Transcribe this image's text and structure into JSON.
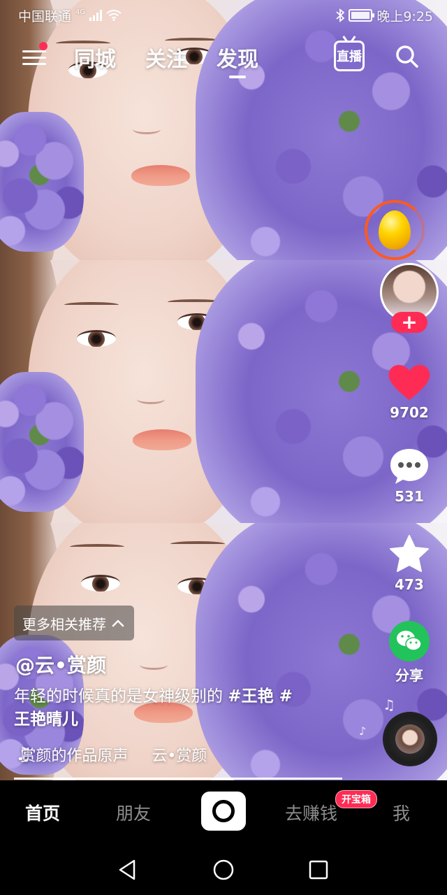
{
  "status_bar": {
    "carrier": "中国联通",
    "network": "4G",
    "time": "晚上9:25"
  },
  "top_nav": {
    "tabs": [
      {
        "label": "同城",
        "active": false
      },
      {
        "label": "关注",
        "active": false
      },
      {
        "label": "发现",
        "active": true
      }
    ],
    "live_label": "直播",
    "icons": [
      "menu-icon",
      "live-icon",
      "search-icon"
    ]
  },
  "right_rail": {
    "coin_timer_icon": "golden-egg-icon",
    "follow_label": "+",
    "likes": "9702",
    "comments": "531",
    "favorites": "473",
    "share_label": "分享",
    "icons": [
      "heart-icon",
      "comment-icon",
      "star-icon",
      "wechat-icon",
      "music-disc-icon"
    ]
  },
  "video_info": {
    "related_label": "更多相关推荐",
    "username": "@云•赏颜",
    "caption_text": "年轻的时候真的是女神级别的 ",
    "hashtag_1": "#王艳 #",
    "hashtag_2": "王艳晴儿",
    "music_text_1": "赏颜的作品原声",
    "music_text_2": "云•赏颜",
    "progress": 1.0
  },
  "tab_bar": {
    "items": [
      {
        "label": "首页",
        "active": true
      },
      {
        "label": "朋友",
        "active": false
      },
      {
        "label": "去赚钱",
        "active": false
      },
      {
        "label": "我",
        "active": false
      }
    ],
    "earn_badge": "开宝箱"
  },
  "colors": {
    "accent_red": "#fe2c55",
    "share_green": "#22c35a",
    "timer_orange": "#ff5a1f"
  }
}
